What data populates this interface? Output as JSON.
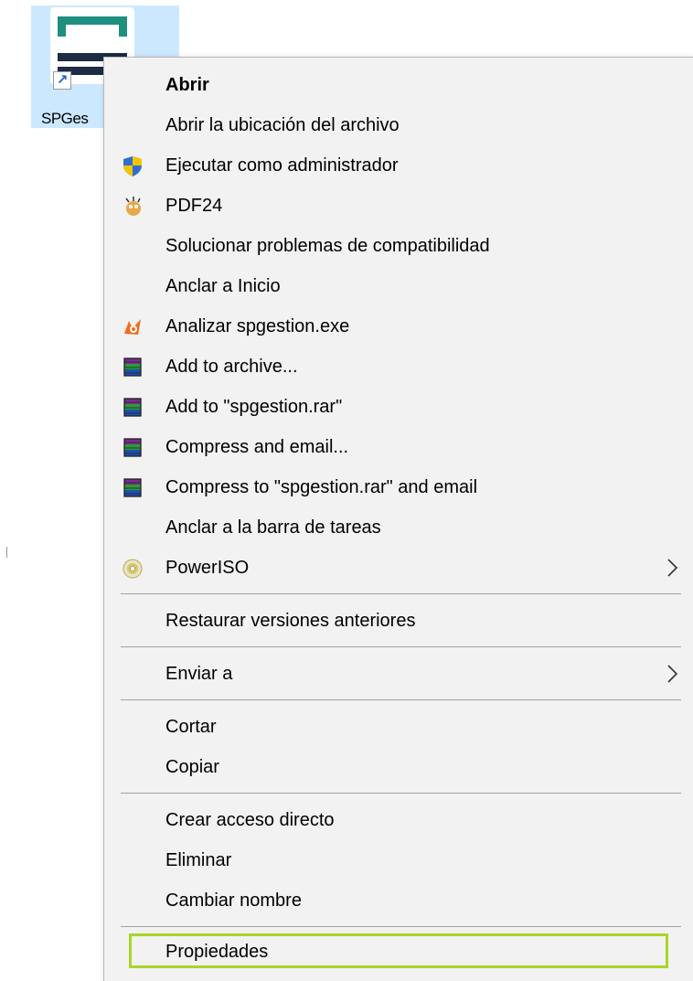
{
  "desktop_icon": {
    "label": "SPGes",
    "shortcut_glyph": "↗",
    "icon": "spgestion-app-icon"
  },
  "menu": {
    "items": [
      {
        "label": "Abrir",
        "icon": "none"
      },
      {
        "label": "Abrir la ubicación del archivo",
        "icon": "none"
      },
      {
        "label": "Ejecutar como administrador",
        "icon": "uac-shield-icon"
      },
      {
        "label": "PDF24",
        "icon": "pdf24-icon"
      },
      {
        "label": "Solucionar problemas de compatibilidad",
        "icon": "none"
      },
      {
        "label": "Anclar a Inicio",
        "icon": "none"
      },
      {
        "label": "Analizar spgestion.exe",
        "icon": "avast-icon"
      },
      {
        "label": "Add to archive...",
        "icon": "winrar-icon"
      },
      {
        "label": "Add to \"spgestion.rar\"",
        "icon": "winrar-icon"
      },
      {
        "label": "Compress and email...",
        "icon": "winrar-icon"
      },
      {
        "label": "Compress to \"spgestion.rar\" and email",
        "icon": "winrar-icon"
      },
      {
        "label": "Anclar a la barra de tareas",
        "icon": "none"
      },
      {
        "label": "PowerISO",
        "icon": "poweriso-icon"
      },
      {
        "label": "Restaurar versiones anteriores",
        "icon": "none"
      },
      {
        "label": "Enviar a",
        "icon": "none"
      },
      {
        "label": "Cortar",
        "icon": "none"
      },
      {
        "label": "Copiar",
        "icon": "none"
      },
      {
        "label": "Crear acceso directo",
        "icon": "none"
      },
      {
        "label": "Eliminar",
        "icon": "none"
      },
      {
        "label": "Cambiar nombre",
        "icon": "none"
      },
      {
        "label": "Propiedades",
        "icon": "none"
      }
    ],
    "highlighted_item": "Propiedades",
    "colors": {
      "menu_bg": "#f2f2f2",
      "highlight_border": "#a8d626",
      "selection_bg": "#cce8ff"
    }
  }
}
